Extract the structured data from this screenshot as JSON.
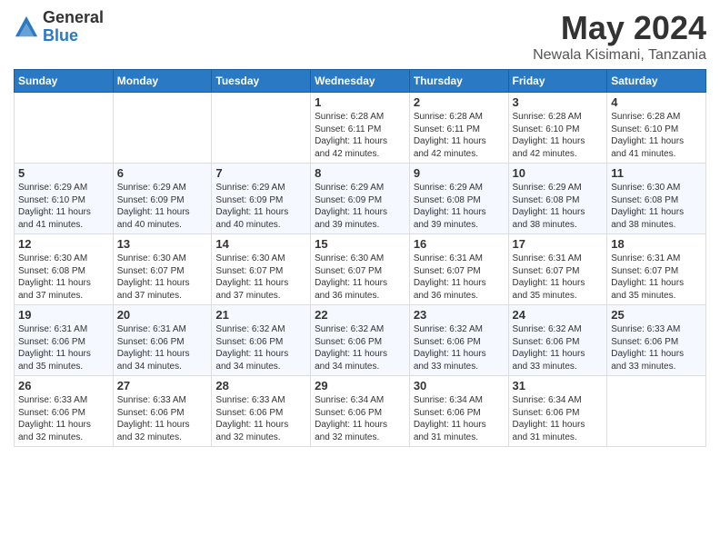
{
  "logo": {
    "general": "General",
    "blue": "Blue"
  },
  "title": {
    "month_year": "May 2024",
    "location": "Newala Kisimani, Tanzania"
  },
  "days_of_week": [
    "Sunday",
    "Monday",
    "Tuesday",
    "Wednesday",
    "Thursday",
    "Friday",
    "Saturday"
  ],
  "weeks": [
    [
      {
        "day": "",
        "lines": []
      },
      {
        "day": "",
        "lines": []
      },
      {
        "day": "",
        "lines": []
      },
      {
        "day": "1",
        "lines": [
          "Sunrise: 6:28 AM",
          "Sunset: 6:11 PM",
          "Daylight: 11 hours",
          "and 42 minutes."
        ]
      },
      {
        "day": "2",
        "lines": [
          "Sunrise: 6:28 AM",
          "Sunset: 6:11 PM",
          "Daylight: 11 hours",
          "and 42 minutes."
        ]
      },
      {
        "day": "3",
        "lines": [
          "Sunrise: 6:28 AM",
          "Sunset: 6:10 PM",
          "Daylight: 11 hours",
          "and 42 minutes."
        ]
      },
      {
        "day": "4",
        "lines": [
          "Sunrise: 6:28 AM",
          "Sunset: 6:10 PM",
          "Daylight: 11 hours",
          "and 41 minutes."
        ]
      }
    ],
    [
      {
        "day": "5",
        "lines": [
          "Sunrise: 6:29 AM",
          "Sunset: 6:10 PM",
          "Daylight: 11 hours",
          "and 41 minutes."
        ]
      },
      {
        "day": "6",
        "lines": [
          "Sunrise: 6:29 AM",
          "Sunset: 6:09 PM",
          "Daylight: 11 hours",
          "and 40 minutes."
        ]
      },
      {
        "day": "7",
        "lines": [
          "Sunrise: 6:29 AM",
          "Sunset: 6:09 PM",
          "Daylight: 11 hours",
          "and 40 minutes."
        ]
      },
      {
        "day": "8",
        "lines": [
          "Sunrise: 6:29 AM",
          "Sunset: 6:09 PM",
          "Daylight: 11 hours",
          "and 39 minutes."
        ]
      },
      {
        "day": "9",
        "lines": [
          "Sunrise: 6:29 AM",
          "Sunset: 6:08 PM",
          "Daylight: 11 hours",
          "and 39 minutes."
        ]
      },
      {
        "day": "10",
        "lines": [
          "Sunrise: 6:29 AM",
          "Sunset: 6:08 PM",
          "Daylight: 11 hours",
          "and 38 minutes."
        ]
      },
      {
        "day": "11",
        "lines": [
          "Sunrise: 6:30 AM",
          "Sunset: 6:08 PM",
          "Daylight: 11 hours",
          "and 38 minutes."
        ]
      }
    ],
    [
      {
        "day": "12",
        "lines": [
          "Sunrise: 6:30 AM",
          "Sunset: 6:08 PM",
          "Daylight: 11 hours",
          "and 37 minutes."
        ]
      },
      {
        "day": "13",
        "lines": [
          "Sunrise: 6:30 AM",
          "Sunset: 6:07 PM",
          "Daylight: 11 hours",
          "and 37 minutes."
        ]
      },
      {
        "day": "14",
        "lines": [
          "Sunrise: 6:30 AM",
          "Sunset: 6:07 PM",
          "Daylight: 11 hours",
          "and 37 minutes."
        ]
      },
      {
        "day": "15",
        "lines": [
          "Sunrise: 6:30 AM",
          "Sunset: 6:07 PM",
          "Daylight: 11 hours",
          "and 36 minutes."
        ]
      },
      {
        "day": "16",
        "lines": [
          "Sunrise: 6:31 AM",
          "Sunset: 6:07 PM",
          "Daylight: 11 hours",
          "and 36 minutes."
        ]
      },
      {
        "day": "17",
        "lines": [
          "Sunrise: 6:31 AM",
          "Sunset: 6:07 PM",
          "Daylight: 11 hours",
          "and 35 minutes."
        ]
      },
      {
        "day": "18",
        "lines": [
          "Sunrise: 6:31 AM",
          "Sunset: 6:07 PM",
          "Daylight: 11 hours",
          "and 35 minutes."
        ]
      }
    ],
    [
      {
        "day": "19",
        "lines": [
          "Sunrise: 6:31 AM",
          "Sunset: 6:06 PM",
          "Daylight: 11 hours",
          "and 35 minutes."
        ]
      },
      {
        "day": "20",
        "lines": [
          "Sunrise: 6:31 AM",
          "Sunset: 6:06 PM",
          "Daylight: 11 hours",
          "and 34 minutes."
        ]
      },
      {
        "day": "21",
        "lines": [
          "Sunrise: 6:32 AM",
          "Sunset: 6:06 PM",
          "Daylight: 11 hours",
          "and 34 minutes."
        ]
      },
      {
        "day": "22",
        "lines": [
          "Sunrise: 6:32 AM",
          "Sunset: 6:06 PM",
          "Daylight: 11 hours",
          "and 34 minutes."
        ]
      },
      {
        "day": "23",
        "lines": [
          "Sunrise: 6:32 AM",
          "Sunset: 6:06 PM",
          "Daylight: 11 hours",
          "and 33 minutes."
        ]
      },
      {
        "day": "24",
        "lines": [
          "Sunrise: 6:32 AM",
          "Sunset: 6:06 PM",
          "Daylight: 11 hours",
          "and 33 minutes."
        ]
      },
      {
        "day": "25",
        "lines": [
          "Sunrise: 6:33 AM",
          "Sunset: 6:06 PM",
          "Daylight: 11 hours",
          "and 33 minutes."
        ]
      }
    ],
    [
      {
        "day": "26",
        "lines": [
          "Sunrise: 6:33 AM",
          "Sunset: 6:06 PM",
          "Daylight: 11 hours",
          "and 32 minutes."
        ]
      },
      {
        "day": "27",
        "lines": [
          "Sunrise: 6:33 AM",
          "Sunset: 6:06 PM",
          "Daylight: 11 hours",
          "and 32 minutes."
        ]
      },
      {
        "day": "28",
        "lines": [
          "Sunrise: 6:33 AM",
          "Sunset: 6:06 PM",
          "Daylight: 11 hours",
          "and 32 minutes."
        ]
      },
      {
        "day": "29",
        "lines": [
          "Sunrise: 6:34 AM",
          "Sunset: 6:06 PM",
          "Daylight: 11 hours",
          "and 32 minutes."
        ]
      },
      {
        "day": "30",
        "lines": [
          "Sunrise: 6:34 AM",
          "Sunset: 6:06 PM",
          "Daylight: 11 hours",
          "and 31 minutes."
        ]
      },
      {
        "day": "31",
        "lines": [
          "Sunrise: 6:34 AM",
          "Sunset: 6:06 PM",
          "Daylight: 11 hours",
          "and 31 minutes."
        ]
      },
      {
        "day": "",
        "lines": []
      }
    ]
  ]
}
